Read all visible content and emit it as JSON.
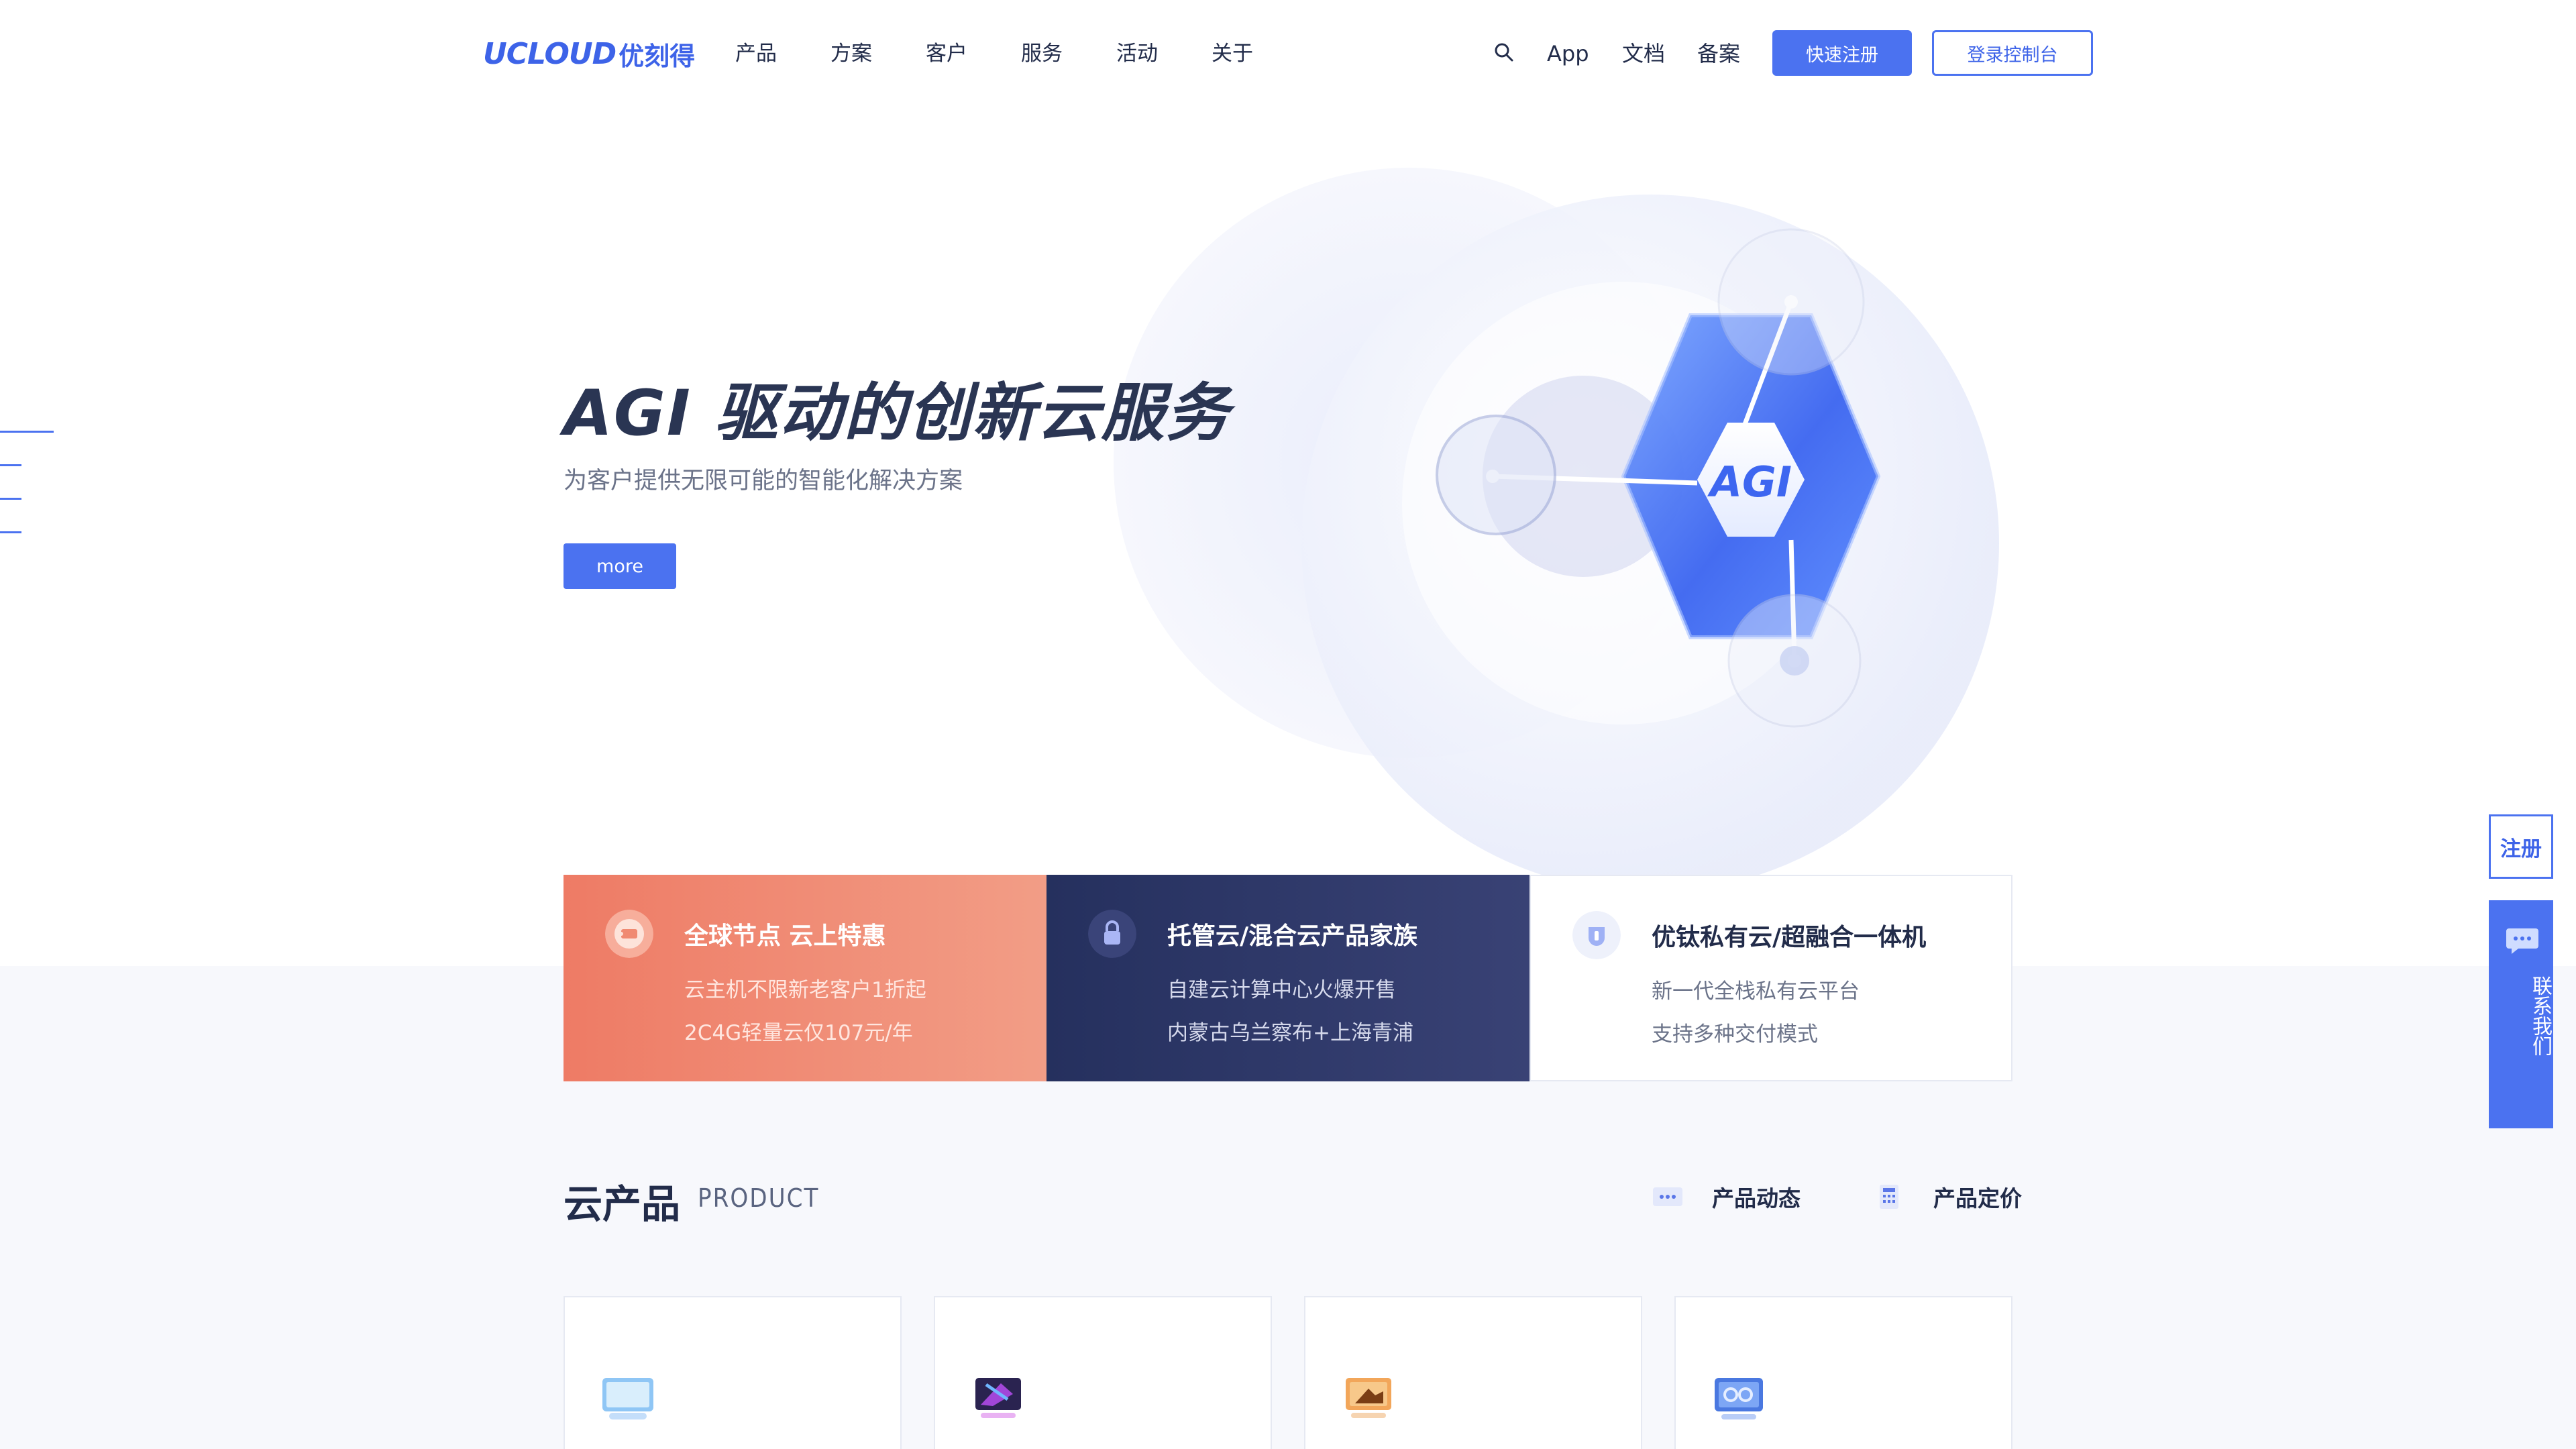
{
  "header": {
    "logo_en": "UCLOUD",
    "logo_cn": "优刻得",
    "nav": [
      "产品",
      "方案",
      "客户",
      "服务",
      "活动",
      "关于"
    ],
    "links": {
      "app": "App",
      "docs": "文档",
      "filing": "备案"
    },
    "register_label": "快速注册",
    "console_label": "登录控制台"
  },
  "hero": {
    "title": "AGI 驱动的创新云服务",
    "subtitle": "为客户提供无限可能的智能化解决方案",
    "more_label": "more",
    "graphic_label": "AGI"
  },
  "promos": [
    {
      "title": "全球节点 云上特惠",
      "lines": [
        "云主机不限新老客户1折起",
        "2C4G轻量云仅107元/年"
      ],
      "icon": "ticket-icon"
    },
    {
      "title": "托管云/混合云产品家族",
      "lines": [
        "自建云计算中心火爆开售",
        "内蒙古乌兰察布+上海青浦"
      ],
      "icon": "lock-icon"
    },
    {
      "title": "优钛私有云/超融合一体机",
      "lines": [
        "新一代全栈私有云平台",
        "支持多种交付模式"
      ],
      "icon": "badge-icon"
    }
  ],
  "products": {
    "title": "云产品",
    "subtitle": "PRODUCT",
    "link_news": "产品动态",
    "link_pricing": "产品定价"
  },
  "float": {
    "register": "注册",
    "contact": "联系我们"
  },
  "colors": {
    "brand": "#4b72f0",
    "text": "#222c4a",
    "promo_coral": "#ee7b65",
    "promo_navy": "#25305e"
  }
}
